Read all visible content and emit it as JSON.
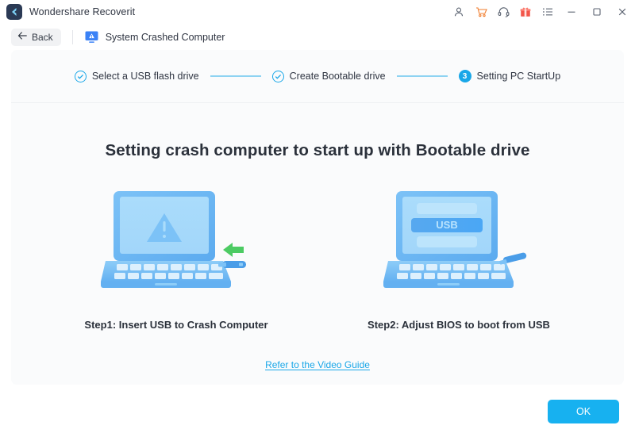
{
  "titlebar": {
    "app_title": "Wondershare Recoverit",
    "logo_icon": "recoverit-logo-icon",
    "icons": [
      {
        "name": "account-icon",
        "glyph": "person"
      },
      {
        "name": "cart-icon",
        "glyph": "cart",
        "color": "#f07d2e"
      },
      {
        "name": "support-icon",
        "glyph": "headset"
      },
      {
        "name": "gift-icon",
        "glyph": "gift",
        "color": "#f2564a"
      },
      {
        "name": "menu-list-icon",
        "glyph": "list"
      },
      {
        "name": "minimize-button",
        "glyph": "minimize"
      },
      {
        "name": "maximize-button",
        "glyph": "maximize"
      },
      {
        "name": "close-button",
        "glyph": "close"
      }
    ]
  },
  "subheader": {
    "back_label": "Back",
    "back_icon": "arrow-left-icon",
    "module_icon": "system-crashed-computer-icon",
    "module_title": "System Crashed Computer"
  },
  "stepper": {
    "steps": [
      {
        "label": "Select a USB flash drive",
        "state": "done",
        "marker": "check"
      },
      {
        "label": "Create Bootable drive",
        "state": "done",
        "marker": "check"
      },
      {
        "label": "Setting PC StartUp",
        "state": "active",
        "marker": "3"
      }
    ]
  },
  "main": {
    "title": "Setting crash computer to start up with Bootable drive",
    "illustrations": [
      {
        "icon": "laptop-crashed-with-usb-illustration",
        "screen_text": "",
        "caption": "Step1:  Insert USB to Crash Computer"
      },
      {
        "icon": "laptop-bios-usb-illustration",
        "screen_text": "USB",
        "caption": "Step2: Adjust BIOS to boot from USB"
      }
    ],
    "video_link": "Refer to the Video Guide"
  },
  "footer": {
    "ok_label": "OK"
  },
  "colors": {
    "accent_blue": "#1aa7e8",
    "button_blue": "#17b1f0",
    "cart_orange": "#f07d2e",
    "gift_red": "#f2564a",
    "arrow_green": "#4ccb63",
    "laptop_blue": "#6cb8f5",
    "card_bg": "#fafbfc"
  }
}
